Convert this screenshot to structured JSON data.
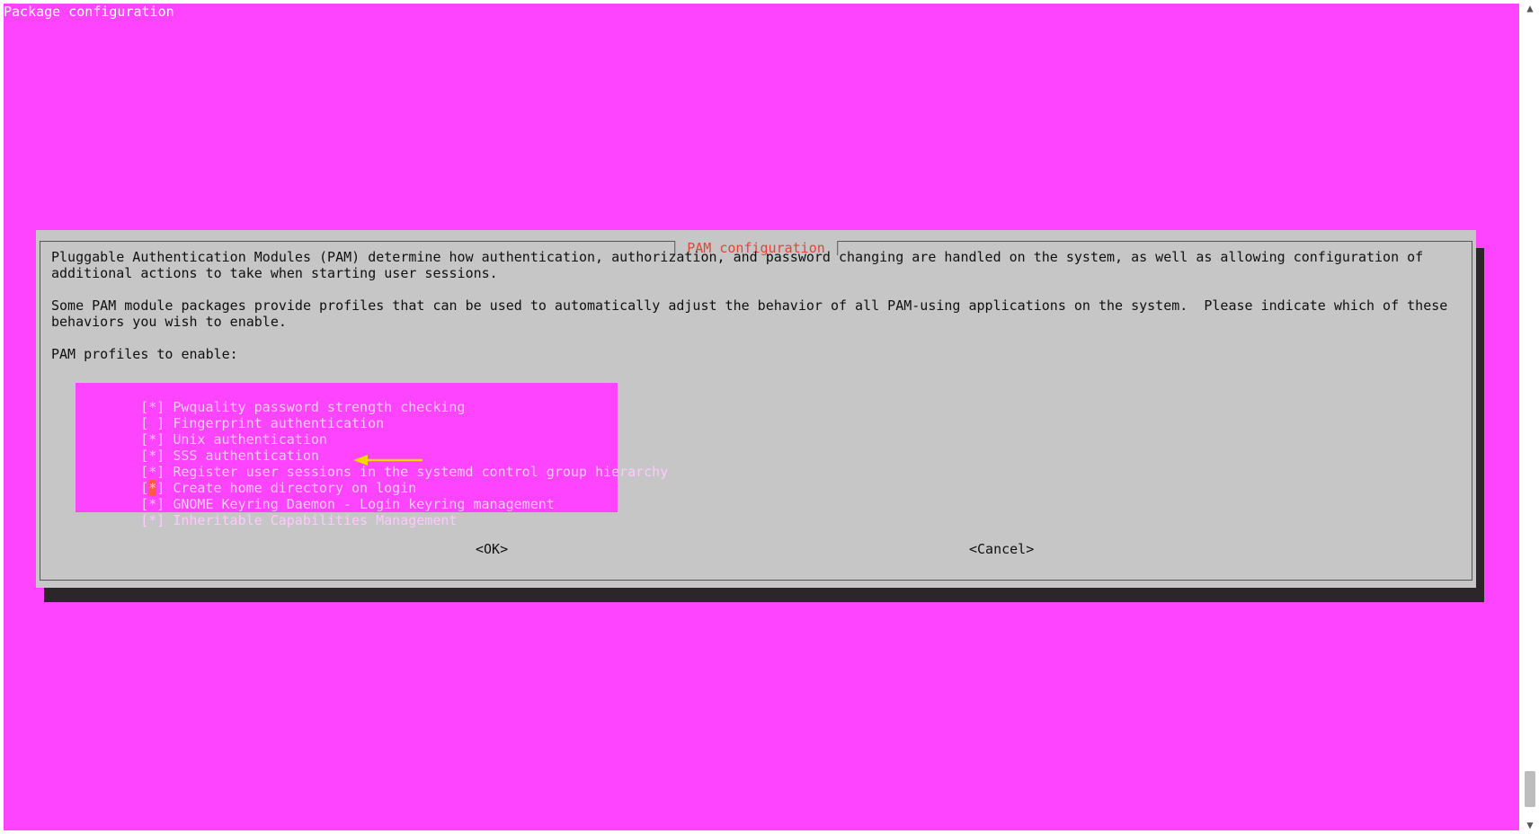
{
  "window": {
    "title": "Package configuration"
  },
  "dialog": {
    "title": "PAM configuration",
    "description_line1": "Pluggable Authentication Modules (PAM) determine how authentication, authorization, and password changing are handled on the system, as well as allowing configuration of",
    "description_line2": "additional actions to take when starting user sessions.",
    "info_line1": "Some PAM module packages provide profiles that can be used to automatically adjust the behavior of all PAM-using applications on the system.  Please indicate which of these",
    "info_line2": "behaviors you wish to enable.",
    "list_label": "PAM profiles to enable:",
    "profiles": [
      {
        "checkbox": "[*]",
        "label": "Pwquality password strength checking",
        "checked": true
      },
      {
        "checkbox": "[ ]",
        "label": "Fingerprint authentication",
        "checked": false
      },
      {
        "checkbox": "[*]",
        "label": "Unix authentication",
        "checked": true
      },
      {
        "checkbox": "[*]",
        "label": "SSS authentication",
        "checked": true
      },
      {
        "checkbox": "[*]",
        "label": "Register user sessions in the systemd control group hierarchy",
        "checked": true
      },
      {
        "checkbox": "[*]",
        "label": "Create home directory on login",
        "checked": true
      },
      {
        "checkbox": "[*]",
        "label": "GNOME Keyring Daemon - Login keyring management",
        "checked": true
      },
      {
        "checkbox": "[*]",
        "label": "Inheritable Capabilities Management",
        "checked": true
      }
    ],
    "ok_label": "<OK>",
    "cancel_label": "<Cancel>"
  },
  "annotation": {
    "icon": "arrow-left-icon",
    "color": "#f5d800"
  },
  "colors": {
    "terminal_bg": "#ff44ff",
    "dialog_bg": "#c6c6c6",
    "dialog_title": "#e0453a",
    "list_text": "#ffc8ff",
    "cursor": "#ff5a4a"
  },
  "scrollbar": {
    "up_icon": "chevron-up-icon",
    "down_icon": "chevron-down-icon"
  }
}
